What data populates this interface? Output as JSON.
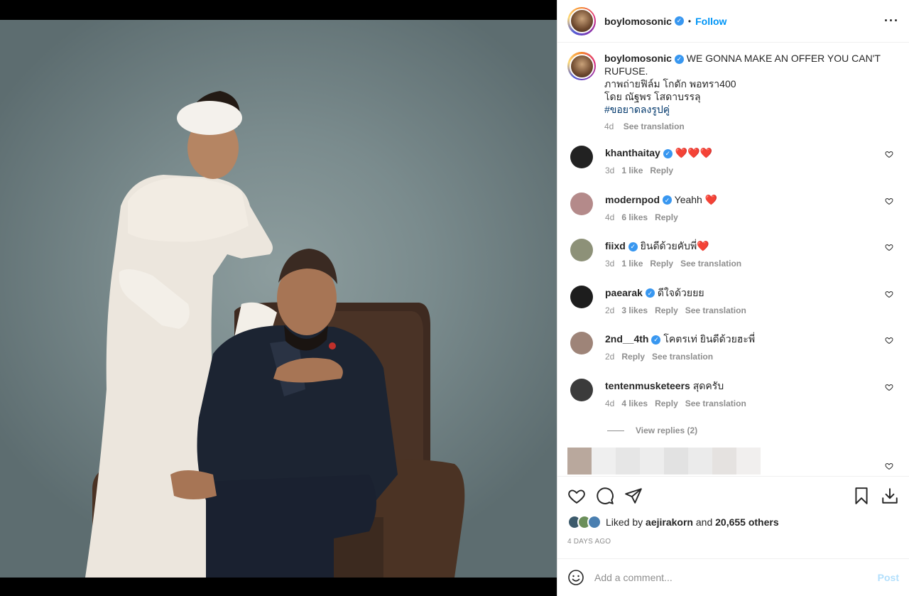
{
  "post": {
    "username": "boylomosonic",
    "follow_label": "Follow",
    "more_icon": "more-options-icon",
    "caption_lines": [
      "WE GONNA MAKE AN OFFER YOU CAN'T RUFUSE.",
      "ภาพถ่ายฟิล์ม โกดัก พอทรา400",
      "โดย ณัฐพร โสดาบรรลุ"
    ],
    "hashtag": "#ขอยาดลงรูปคู่",
    "caption_time": "4d",
    "see_translation": "See translation"
  },
  "comments": [
    {
      "user": "khanthaitay",
      "verified": true,
      "text": "❤️❤️❤️",
      "time": "3d",
      "likes": "1 like",
      "reply": "Reply",
      "translate": "",
      "avatar_color": "#222222"
    },
    {
      "user": "modernpod",
      "verified": true,
      "text": "Yeahh ❤️",
      "time": "4d",
      "likes": "6 likes",
      "reply": "Reply",
      "translate": "",
      "avatar_color": "#b48a8a"
    },
    {
      "user": "fiixd",
      "verified": true,
      "text": "ยินดีด้วยคับพี่❤️",
      "time": "3d",
      "likes": "1 like",
      "reply": "Reply",
      "translate": "See translation",
      "avatar_color": "#8d9178"
    },
    {
      "user": "paearak",
      "verified": true,
      "text": "ดีใจด้วยยย",
      "time": "2d",
      "likes": "3 likes",
      "reply": "Reply",
      "translate": "See translation",
      "avatar_color": "#1d1d1d"
    },
    {
      "user": "2nd__4th",
      "verified": true,
      "text": "โคตรเท่ ยินดีด้วยฮะพี่",
      "time": "2d",
      "likes": "",
      "reply": "Reply",
      "translate": "See translation",
      "avatar_color": "#9e8478"
    },
    {
      "user": "tentenmusketeers",
      "verified": false,
      "text": "สุดครับ",
      "time": "4d",
      "likes": "4 likes",
      "reply": "Reply",
      "translate": "See translation",
      "avatar_color": "#3b3b3b"
    }
  ],
  "view_replies": "View replies (2)",
  "liked_by": {
    "prefix": "Liked by",
    "user": "aejirakorn",
    "and": "and",
    "others": "20,655 others"
  },
  "post_date": "4 DAYS AGO",
  "add_comment": {
    "placeholder": "Add a comment...",
    "post_label": "Post"
  },
  "colors": {
    "link": "#0095f6",
    "verified": "#3897f0",
    "muted": "#8e8e8e",
    "hashtag": "#00376b"
  }
}
